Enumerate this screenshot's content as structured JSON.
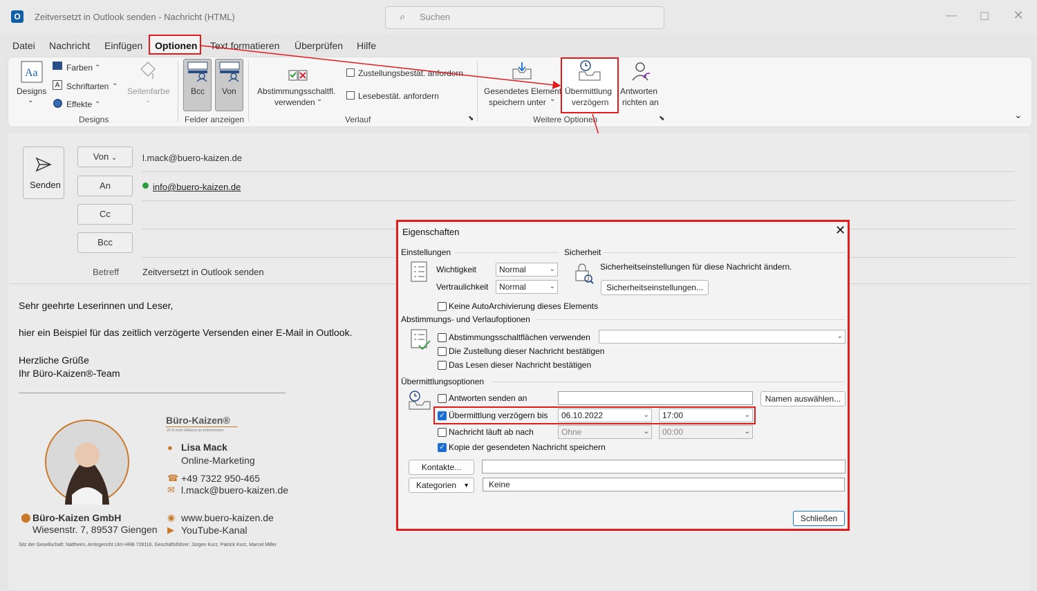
{
  "window": {
    "title": "Zeitversetzt in Outlook senden  -  Nachricht (HTML)",
    "search_placeholder": "Suchen"
  },
  "menu": [
    "Datei",
    "Nachricht",
    "Einfügen",
    "Optionen",
    "Text formatieren",
    "Überprüfen",
    "Hilfe"
  ],
  "ribbon": {
    "designs": "Designs",
    "farben": "Farben",
    "schriftarten": "Schriftarten",
    "effekte": "Effekte",
    "seitenfarbe": "Seitenfarbe",
    "group_designs": "Designs",
    "bcc": "Bcc",
    "von": "Von",
    "group_felder": "Felder anzeigen",
    "abstimmung_1": "Abstimmungsschaltfl.",
    "abstimmung_2": "verwenden",
    "zustellung": "Zustellungsbestät. anfordern",
    "lesebest": "Lesebestät. anfordern",
    "group_verlauf": "Verlauf",
    "gesendet_1": "Gesendetes Element",
    "gesendet_2": "speichern unter",
    "uebermittlung_1": "Übermittlung",
    "uebermittlung_2": "verzögern",
    "antworten_1": "Antworten",
    "antworten_2": "richten an",
    "group_weitere": "Weitere Optionen"
  },
  "compose": {
    "send": "Senden",
    "from_btn": "Von",
    "from_value": "l.mack@buero-kaizen.de",
    "to_btn": "An",
    "to_value": "info@buero-kaizen.de",
    "cc_btn": "Cc",
    "bcc_btn": "Bcc",
    "subject_label": "Betreff",
    "subject_value": "Zeitversetzt in Outlook senden"
  },
  "body": {
    "line1": "Sehr geehrte Leserinnen und Leser,",
    "line2": "hier ein Beispiel für das zeitlich verzögerte Versenden einer E-Mail in Outlook.",
    "line3": "Herzliche Grüße",
    "line4": "Ihr Büro-Kaizen®-Team"
  },
  "signature": {
    "logo": "Büro-Kaizen®",
    "logo_tagline": "20 % mehr Effizienz im Unternehmen",
    "name": "Lisa Mack",
    "role": "Online-Marketing",
    "phone": "+49 7322 950-465",
    "email": "l.mack@buero-kaizen.de",
    "company": "Büro-Kaizen GmbH",
    "address": "Wiesenstr. 7, 89537 Giengen",
    "web": "www.buero-kaizen.de",
    "youtube": "YouTube-Kanal",
    "legal": "Sitz der Gesellschaft: Nattheim, Amtsgericht Ulm HRB 728116, Geschäftsführer: Jürgen Kurz, Patrick Kurz, Marcel Miller"
  },
  "dialog": {
    "title": "Eigenschaften",
    "einstellungen": "Einstellungen",
    "sicherheit": "Sicherheit",
    "wichtigkeit": "Wichtigkeit",
    "wichtigkeit_value": "Normal",
    "vertraulichkeit": "Vertraulichkeit",
    "vertraulichkeit_value": "Normal",
    "sicherheit_text": "Sicherheitseinstellungen für diese Nachricht ändern.",
    "sicherheit_btn": "Sicherheitseinstellungen...",
    "keine_archiv": "Keine AutoArchivierung dieses Elements",
    "abstimmung_section": "Abstimmungs- und Verlaufoptionen",
    "abstimmung_chk": "Abstimmungsschaltflächen verwenden",
    "zustellung_chk": "Die Zustellung dieser Nachricht bestätigen",
    "lesen_chk": "Das Lesen dieser Nachricht bestätigen",
    "uebermittlung_section": "Übermittlungsoptionen",
    "antworten_chk": "Antworten senden an",
    "namen_btn": "Namen auswählen...",
    "verzoegern_chk": "Übermittlung verzögern bis",
    "verzoegern_date": "06.10.2022",
    "verzoegern_time": "17:00",
    "ablauf_chk": "Nachricht läuft ab nach",
    "ablauf_date": "Ohne",
    "ablauf_time": "00:00",
    "kopie_chk": "Kopie der gesendeten Nachricht speichern",
    "kontakte_btn": "Kontakte...",
    "kategorien_btn": "Kategorien",
    "kategorien_value": "Keine",
    "schliessen_btn": "Schließen"
  },
  "colors": {
    "highlight": "#e21b1b",
    "accent": "#1a6fd0",
    "brand_orange": "#c87a2a"
  }
}
